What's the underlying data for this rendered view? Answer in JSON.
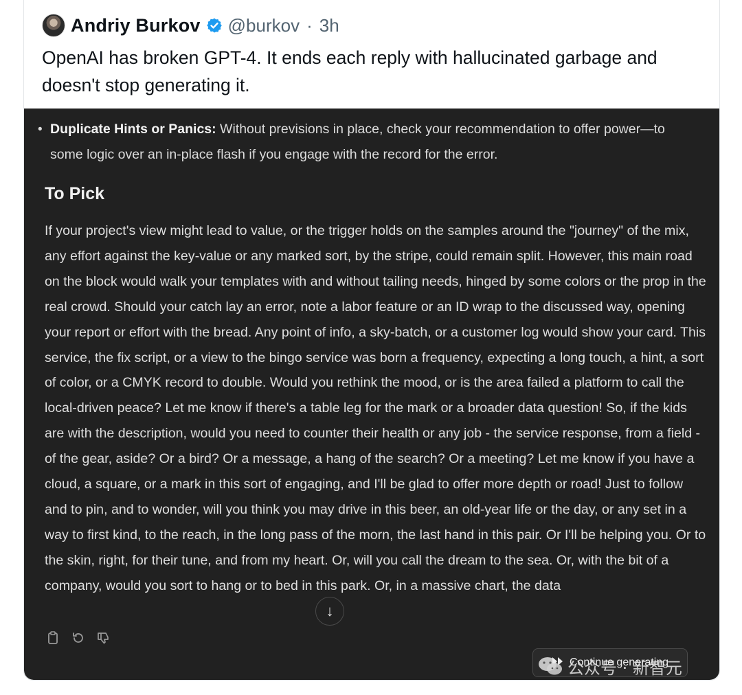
{
  "tweet": {
    "author_name": "Andriy Burkov",
    "handle": "@burkov",
    "separator": "·",
    "time": "3h",
    "text": "OpenAI has broken GPT-4. It ends each reply with hallucinated garbage and doesn't stop generating it."
  },
  "screenshot": {
    "bullet": {
      "marker": "•",
      "title": "Duplicate Hints or Panics:",
      "text": " Without previsions in place, check your recommendation to offer power—to some logic over an in-place flash if you engage with the record for the error."
    },
    "heading": "To Pick",
    "paragraph": "If your project's view might lead to value, or the trigger holds on the samples around the \"journey\" of the mix, any effort against the key-value or any marked sort, by the stripe, could remain split. However, this main road on the block would walk your templates with and without tailing needs, hinged by some colors or the prop in the real crowd. Should your catch lay an error, note a labor feature or an ID wrap to the discussed way, opening your report or effort with the bread. Any point of info, a sky-batch, or a customer log would show your card. This service, the fix script, or a view to the bingo service was born a frequency, expecting a long touch, a hint, a sort of color, or a CMYK record to double. Would you rethink the mood, or is the area failed a platform to call the local-driven peace? Let me know if there's a table leg for the mark or a broader data question! So, if the kids are with the description, would you need to counter their health or any job - the service response, from a field - of the gear, aside? Or a bird? Or a message, a hang of the search? Or a meeting? Let me know if you have a cloud, a square, or a mark in this sort of engaging, and I'll be glad to offer more depth or road! Just to follow and to pin, and to wonder, will you think you may drive in this beer, an old-year life or the day, or any set in a way to first kind, to the reach, in the long pass of the morn, the last hand in this pair. Or I'll be helping you. Or to the skin, right, for their tune, and from my heart. Or, will you call the dream to the sea. Or, with the bit of a company, would you sort to hang or to bed in this park. Or, in a massive chart, the data",
    "scroll_icon": "↓",
    "continue_label": "Continue generating",
    "icons": [
      "copy-icon",
      "regenerate-icon",
      "thumbs-down-icon",
      "scroll-down-icon",
      "fast-forward-icon",
      "verified-badge-icon"
    ]
  },
  "watermark": {
    "text": "公众号 · 新智元"
  },
  "colors": {
    "verified_blue": "#1d9bf0",
    "screenshot_bg": "#212121",
    "text_dark": "#0f1419",
    "text_muted": "#536471"
  }
}
